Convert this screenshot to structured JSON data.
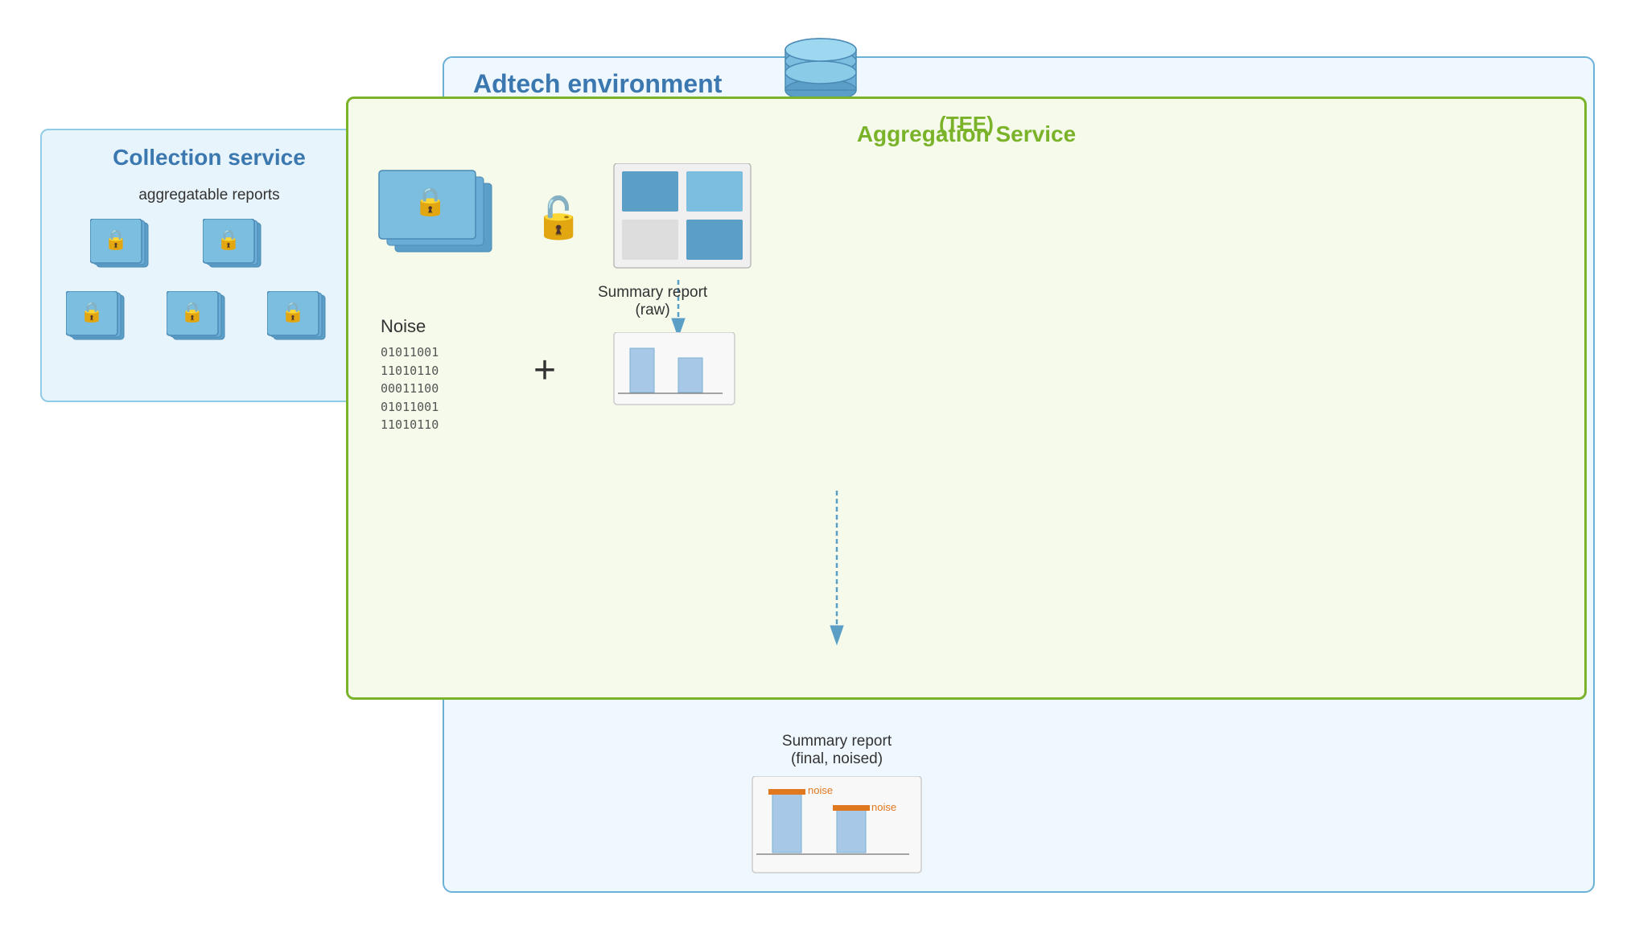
{
  "adtech": {
    "label": "Adtech environment"
  },
  "collection_service": {
    "title": "Collection service",
    "subtitle": "aggregatable reports"
  },
  "aggregation_service": {
    "title": "Aggregation Service",
    "subtitle": "(TEE)"
  },
  "noise_section": {
    "label": "Noise",
    "binary_lines": [
      "01011001",
      "11010110",
      "00011100",
      "01011001",
      "11010110"
    ]
  },
  "summary_raw": {
    "label": "Summary report",
    "sublabel": "(raw)"
  },
  "summary_final": {
    "label": "Summary report",
    "sublabel": "(final, noised)"
  },
  "noise_tag1": "noise",
  "noise_tag2": "noise"
}
